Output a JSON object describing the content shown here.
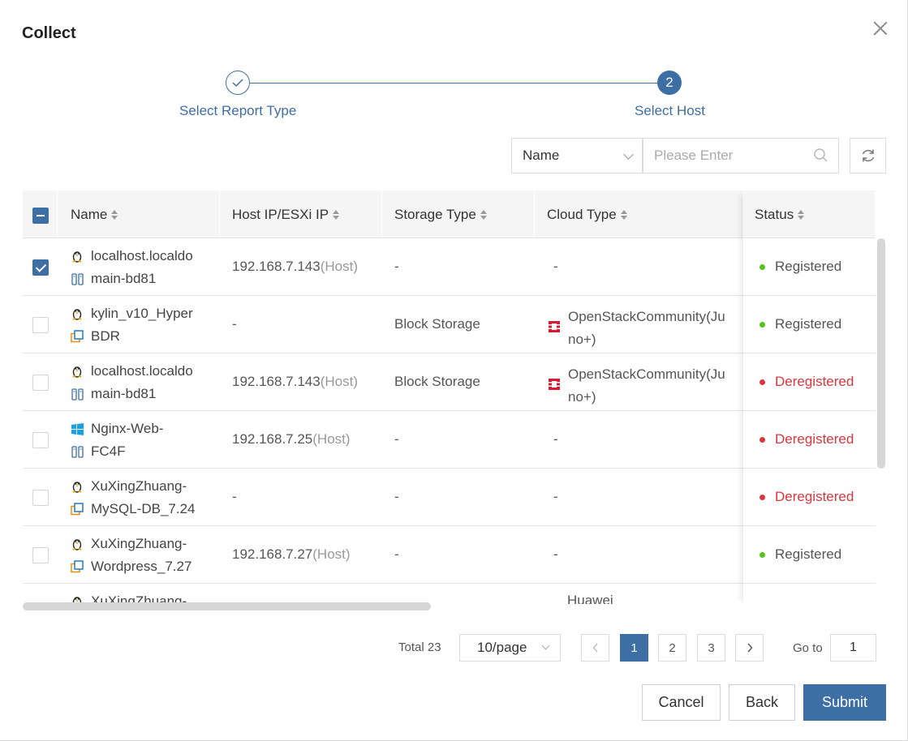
{
  "dialog": {
    "title": "Collect"
  },
  "steps": [
    {
      "label": "Select Report Type",
      "state": "done"
    },
    {
      "label": "Select Host",
      "number": "2",
      "state": "active"
    }
  ],
  "filter": {
    "field": "Name",
    "placeholder": "Please Enter"
  },
  "table": {
    "columns": [
      "Name",
      "Host IP/ESXi IP",
      "Storage Type",
      "Cloud Type",
      "Status"
    ],
    "rows": [
      {
        "checked": true,
        "name1": "localhost.localdo",
        "name2": "main-bd81",
        "os_icon": "linux-icon",
        "type_icon": "physical-host-icon",
        "ip": "192.168.7.143",
        "ip_suffix": "(Host)",
        "storage": "-",
        "cloud": "-",
        "cloud_line2": "",
        "cloud_icon": "",
        "status": "Registered",
        "status_type": "registered"
      },
      {
        "checked": false,
        "name1": "kylin_v10_Hyper",
        "name2": "BDR",
        "os_icon": "linux-icon",
        "type_icon": "virtual-machine-icon",
        "ip": "-",
        "ip_suffix": "",
        "storage": "Block Storage",
        "cloud": "OpenStackCommunity(Ju",
        "cloud_line2": "no+)",
        "cloud_icon": "openstack-icon",
        "status": "Registered",
        "status_type": "registered"
      },
      {
        "checked": false,
        "name1": "localhost.localdo",
        "name2": "main-bd81",
        "os_icon": "linux-icon",
        "type_icon": "physical-host-icon",
        "ip": "192.168.7.143",
        "ip_suffix": "(Host)",
        "storage": "Block Storage",
        "cloud": "OpenStackCommunity(Ju",
        "cloud_line2": "no+)",
        "cloud_icon": "openstack-icon",
        "status": "Deregistered",
        "status_type": "deregistered"
      },
      {
        "checked": false,
        "name1": "Nginx-Web-",
        "name2": "FC4F",
        "os_icon": "windows-icon",
        "type_icon": "physical-host-icon",
        "ip": "192.168.7.25",
        "ip_suffix": "(Host)",
        "storage": "-",
        "cloud": "-",
        "cloud_line2": "",
        "cloud_icon": "",
        "status": "Deregistered",
        "status_type": "deregistered"
      },
      {
        "checked": false,
        "name1": "XuXingZhuang-",
        "name2": "MySQL-DB_7.24",
        "os_icon": "linux-icon",
        "type_icon": "virtual-machine-icon",
        "ip": "-",
        "ip_suffix": "",
        "storage": "-",
        "cloud": "-",
        "cloud_line2": "",
        "cloud_icon": "",
        "status": "Deregistered",
        "status_type": "deregistered"
      },
      {
        "checked": false,
        "name1": "XuXingZhuang-",
        "name2": "Wordpress_7.27",
        "os_icon": "linux-icon",
        "type_icon": "virtual-machine-icon",
        "ip": "192.168.7.27",
        "ip_suffix": "(Host)",
        "storage": "-",
        "cloud": "-",
        "cloud_line2": "",
        "cloud_icon": "",
        "status": "Registered",
        "status_type": "registered"
      },
      {
        "checked": false,
        "name1": "XuXingZhuang-",
        "name2": "",
        "os_icon": "linux-icon",
        "type_icon": "",
        "ip": "",
        "ip_suffix": "",
        "storage": "",
        "cloud": "Huawei",
        "cloud_line2": "",
        "cloud_icon": "",
        "status": "",
        "status_type": ""
      }
    ]
  },
  "pagination": {
    "total": "Total 23",
    "page_size": "10/page",
    "pages": [
      "1",
      "2",
      "3"
    ],
    "current": "1",
    "goto_label": "Go to",
    "goto_value": "1"
  },
  "footer": {
    "cancel": "Cancel",
    "back": "Back",
    "submit": "Submit"
  },
  "colors": {
    "primary": "#3d6fa5",
    "registered": "#52c41a",
    "deregistered": "#d9363e",
    "openstack": "#da1a32"
  }
}
